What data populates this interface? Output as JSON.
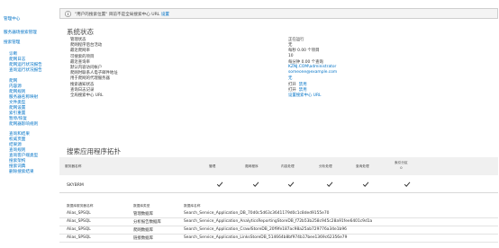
{
  "nav": {
    "central_admin": "管理中心",
    "search_admin": "服务器场搜索管理",
    "search_management": "搜索管理",
    "items": [
      "诊断",
      "爬网日志",
      "爬网运行状况报告",
      "查询运行状况报告",
      "爬网",
      "内容源",
      "爬网规则",
      "服务器名称映射",
      "文件类型",
      "爬网设置",
      "索引重置",
      "暂停/恢复",
      "爬网器影响规则",
      "查询和结果",
      "权威页面",
      "结果源",
      "查询规则",
      "查询客户端类型",
      "搜索架构",
      "搜索词典",
      "删除搜索结果"
    ]
  },
  "notice": {
    "text": "\"用户的搜索位置\" 目前不是全局搜索中心 URL",
    "link": "设置"
  },
  "system_status": {
    "title": "系统状态",
    "rows": [
      {
        "label": "管理状态",
        "value": "正在运行",
        "link": false
      },
      {
        "label": "爬网程序后台活动",
        "value": "无",
        "link": false
      },
      {
        "label": "最近爬网率",
        "value": "每秒 0.00 个项目",
        "link": false
      },
      {
        "label": "可搜索的项目",
        "value": "10",
        "link": false
      },
      {
        "label": "最近查询率",
        "value": "每分钟 0.00 个查询",
        "link": false
      },
      {
        "label": "默认内容访问帐户",
        "value": "KZNJ.COM\\administrator",
        "link": true
      },
      {
        "label": "爬网时联系人电子邮件地址",
        "value": "someone@example.com",
        "link": true
      },
      {
        "label": "用于爬网的代理服务器",
        "value": "无",
        "link": true
      },
      {
        "label": "搜索通知状态",
        "value": "打开",
        "link": false,
        "extra": "禁用"
      },
      {
        "label": "查询日志记录",
        "value": "打开",
        "link": false,
        "extra": "禁用"
      },
      {
        "label": "全局搜索中心 URL",
        "value": "设置搜索中心 URL",
        "link": true
      }
    ]
  },
  "topology": {
    "title": "搜索应用程序拓扑",
    "columns": [
      "服务器名称",
      "管理",
      "爬网程序",
      "内容处理",
      "分析处理",
      "查询处理",
      "索引分区\n0"
    ],
    "rows": [
      {
        "server": "SKYBRM",
        "checks": [
          true,
          true,
          true,
          true,
          true,
          true
        ]
      }
    ]
  },
  "databases": {
    "columns": [
      "数据库服务器名称",
      "数据库类型",
      "数据库名称"
    ],
    "rows": [
      {
        "server": "Alias_SPSQL",
        "type": "管理数据库",
        "name": "Search_Service_Application_DB_70d0c5d63c3641179d0c1c8ded9155e70"
      },
      {
        "server": "Alias_SPSQL",
        "type": "分析报告数据库",
        "name": "Search_Service_Application_AnalyticsReportingStoreDB_f72b53b258c945c28a91fee6401c9d1a"
      },
      {
        "server": "Alias_SPSQL",
        "type": "爬网数据库",
        "name": "Search_Service_Application_CrawlStoreDB_20f9fe187ac98a25ab729776a34e1b96"
      },
      {
        "server": "Alias_SPSQL",
        "type": "链接数据库",
        "name": "Search_Service_Application_LinksStoreDB_514664b8bf974b17bee1369c62356e79"
      }
    ]
  },
  "colors": {
    "link": "#0072c6",
    "header_bg": "#f0f0f0"
  }
}
